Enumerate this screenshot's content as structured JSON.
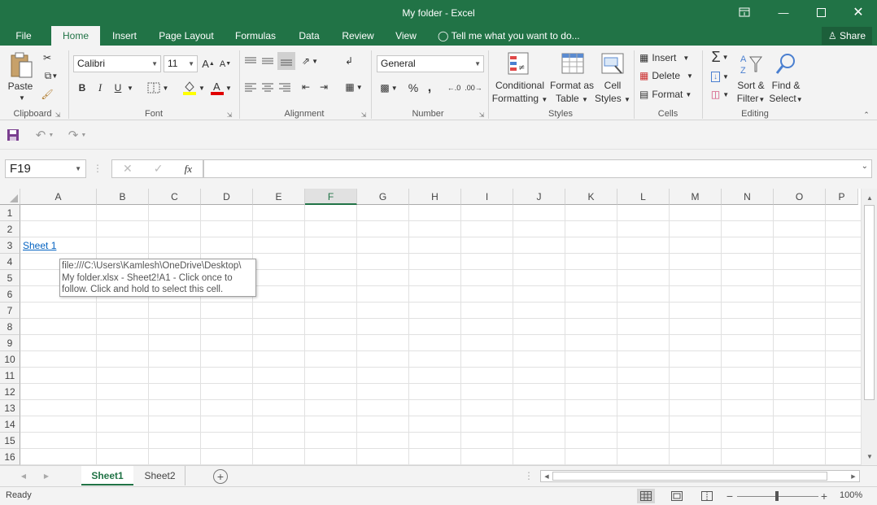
{
  "window": {
    "title": "My folder - Excel"
  },
  "tabs": [
    {
      "label": "File"
    },
    {
      "label": "Home"
    },
    {
      "label": "Insert"
    },
    {
      "label": "Page Layout"
    },
    {
      "label": "Formulas"
    },
    {
      "label": "Data"
    },
    {
      "label": "Review"
    },
    {
      "label": "View"
    }
  ],
  "tell_me": "Tell me what you want to do...",
  "share_label": "Share",
  "ribbon": {
    "clipboard": {
      "label": "Clipboard",
      "paste": "Paste"
    },
    "font": {
      "label": "Font",
      "name": "Calibri",
      "size": "11",
      "bold": "B",
      "italic": "I",
      "underline": "U"
    },
    "alignment": {
      "label": "Alignment"
    },
    "number": {
      "label": "Number",
      "format": "General",
      "percent": "%",
      "comma": ","
    },
    "styles": {
      "label": "Styles",
      "conditional1": "Conditional",
      "conditional2": "Formatting",
      "format_table1": "Format as",
      "format_table2": "Table",
      "cell_styles1": "Cell",
      "cell_styles2": "Styles"
    },
    "cells": {
      "label": "Cells",
      "insert": "Insert",
      "delete": "Delete",
      "format": "Format"
    },
    "editing": {
      "label": "Editing",
      "sort1": "Sort &",
      "sort2": "Filter",
      "find1": "Find &",
      "find2": "Select"
    }
  },
  "formula_bar": {
    "name_box": "F19",
    "formula": ""
  },
  "columns": [
    "A",
    "B",
    "C",
    "D",
    "E",
    "F",
    "G",
    "H",
    "I",
    "J",
    "K",
    "L",
    "M",
    "N",
    "O",
    "P"
  ],
  "selected_column": "F",
  "rows": [
    "1",
    "2",
    "3",
    "4",
    "5",
    "6",
    "7",
    "8",
    "9",
    "10",
    "11",
    "12",
    "13",
    "14",
    "15",
    "16"
  ],
  "cell_a3": "Sheet 1",
  "tooltip": {
    "line1": "file:///C:\\Users\\Kamlesh\\OneDrive\\Desktop\\",
    "line2": "My folder.xlsx - Sheet2!A1 - Click once to",
    "line3": "follow. Click and hold to select this cell."
  },
  "sheets": [
    {
      "label": "Sheet1",
      "active": true
    },
    {
      "label": "Sheet2",
      "active": false
    }
  ],
  "status": {
    "text": "Ready",
    "zoom": "100%"
  },
  "colors": {
    "accent": "#217346",
    "link": "#0563c1"
  }
}
